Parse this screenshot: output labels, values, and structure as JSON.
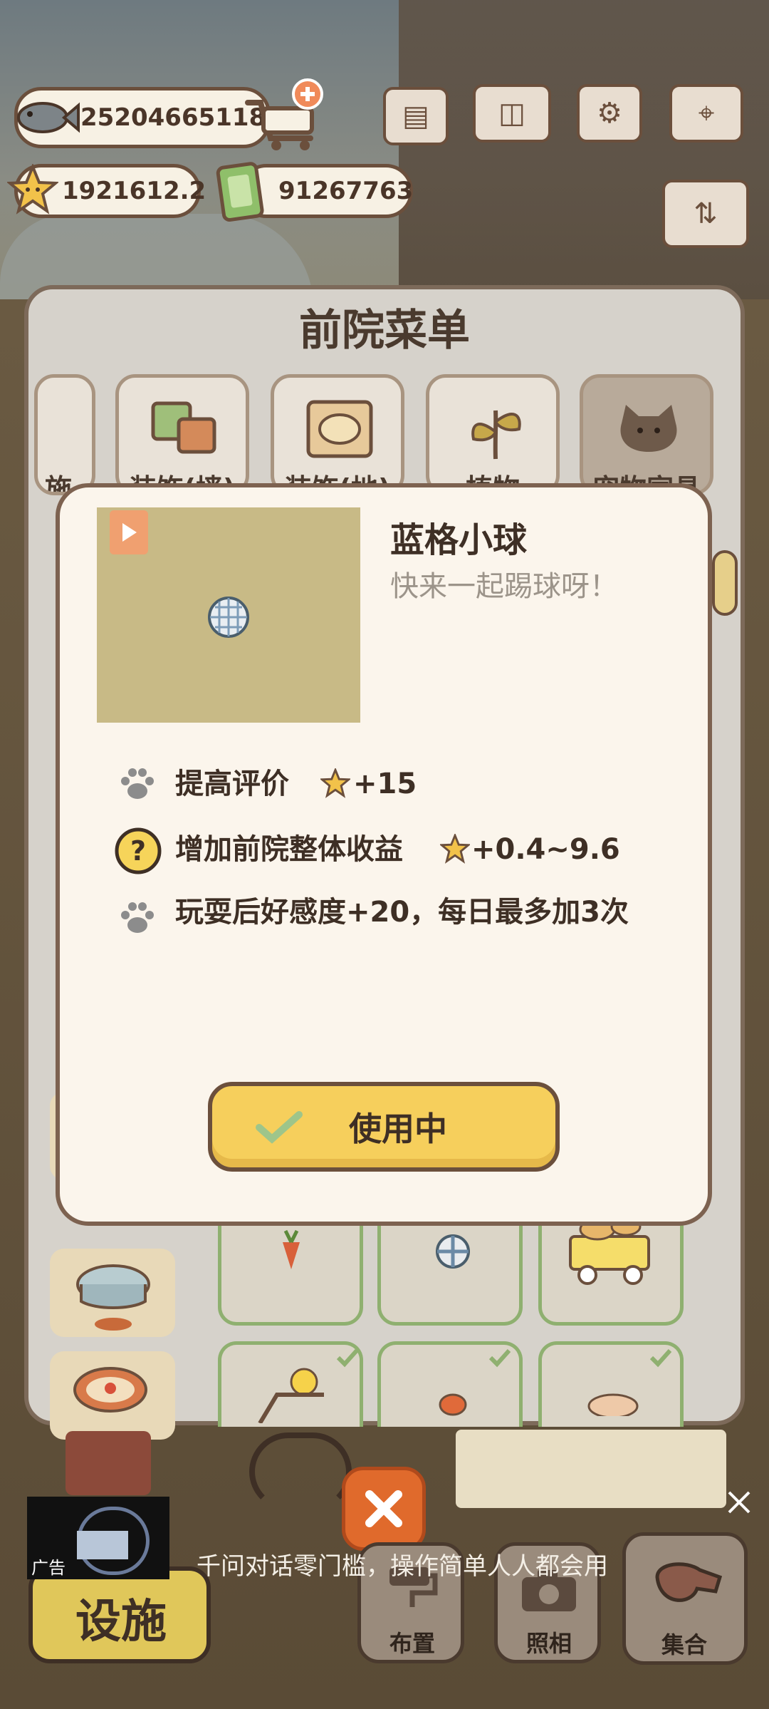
{
  "resources": {
    "fish_coins": "25204665118",
    "stars": "1921612.2",
    "cash": "91267763"
  },
  "menu": {
    "title": "前院菜单",
    "tabs": [
      {
        "label": "施",
        "icon": "facility-icon"
      },
      {
        "label": "装饰(墙)",
        "icon": "wall-decoration-icon"
      },
      {
        "label": "装饰(地)",
        "icon": "floor-decoration-icon"
      },
      {
        "label": "植物",
        "icon": "plant-icon"
      },
      {
        "label": "宠物家具",
        "icon": "cat-furniture-icon"
      }
    ]
  },
  "item": {
    "name": "蓝格小球",
    "description": "快来一起踢球呀！",
    "features": [
      {
        "icon": "paw-icon",
        "text": "提高评价",
        "value": "+15"
      },
      {
        "icon": "question-icon",
        "text": "增加前院整体收益",
        "value": "+0.4~9.6"
      },
      {
        "icon": "paw-icon",
        "text": "玩耍后好感度+20，每日最多加3次"
      }
    ],
    "button_label": "使用中"
  },
  "ad": {
    "badge": "广告",
    "text": "千问对话零门槛，操作简单人人都会用"
  },
  "bottom_nav": {
    "facility": "设施",
    "layout": "布置",
    "photo": "照相",
    "gather": "集合"
  },
  "colors": {
    "popup_bg": "#fbf5ec",
    "button_yellow": "#f6cf5c",
    "close_orange": "#e06a2c",
    "check_green": "#8fb070"
  }
}
